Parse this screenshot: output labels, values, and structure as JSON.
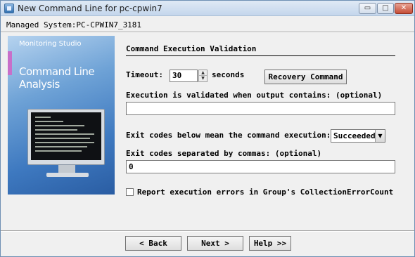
{
  "window": {
    "title": "New Command Line for pc-cpwin7",
    "minimize_glyph": "▭",
    "maximize_glyph": "□",
    "close_glyph": "✕"
  },
  "header": {
    "managed_system": "Managed System:PC-CPWIN7_3181"
  },
  "side_image": {
    "brand": "Monitoring Studio",
    "product_line1": "Command Line",
    "product_line2": "Analysis"
  },
  "section": {
    "title": "Command Execution Validation"
  },
  "timeout": {
    "label": "Timeout:",
    "value": "30",
    "unit": "seconds",
    "up_glyph": "▲",
    "down_glyph": "▼"
  },
  "recovery_button": "Recovery Command",
  "output_validation": {
    "label": "Execution is validated when output contains: (optional)",
    "value": ""
  },
  "exit_mean": {
    "label": "Exit codes below mean the command execution:",
    "selected": "Succeeded",
    "arrow_glyph": "▼"
  },
  "exit_codes": {
    "label": "Exit codes separated by commas: (optional)",
    "value": "0"
  },
  "report_errors": {
    "label": "Report execution errors in Group's CollectionErrorCount",
    "checked": false
  },
  "footer": {
    "back_label": "< Back",
    "next_label": "Next >",
    "help_label": "Help >>"
  }
}
